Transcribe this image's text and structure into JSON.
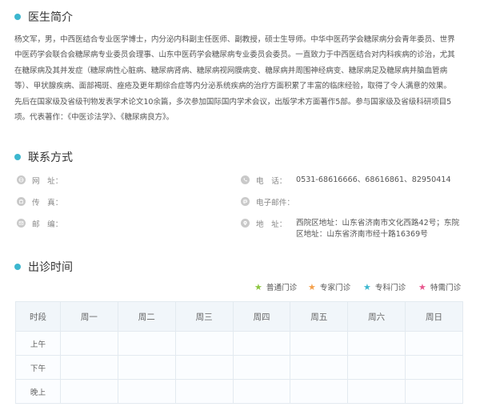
{
  "bio": {
    "title": "医生简介",
    "lines": [
      "杨文军，男，中西医结合专业医学博士，内分泌内科副主任医师、副教授，硕士生导师。中华中医药学会糖尿病分会青年委员、世界",
      "中医药学会联合会糖尿病专业委员会理事、山东中医药学会糖尿病专业委员会委员。一直致力于中西医结合对内科疾病的诊治，尤其",
      "在糖尿病及其并发症（糖尿病性心脏病、糖尿病肾病、糖尿病视网膜病变、糖尿病并周围神经病变、糖尿病足及糖尿病并脑血管病",
      "等）、甲状腺疾病、面部褐斑、痤疮及更年期综合症等内分泌系统疾病的治疗方面积累了丰富的临床经验，取得了令人满意的效果。",
      "先后在国家级及省级刊物发表学术论文10余篇，多次参加国际国内学术会议，出版学术方面著作5部。参与国家级及省级科研项目5",
      "项。代表著作：《中医诊法学》、《糖尿病良方》。"
    ]
  },
  "contact": {
    "title": "联系方式",
    "website_label": "网　址：",
    "website_value": "",
    "fax_label": "传　真：",
    "fax_value": "",
    "postcode_label": "邮　编：",
    "postcode_value": "",
    "phone_label": "电　话：",
    "phone_value": "0531-68616666、68616861、82950414",
    "email_label": "电子邮件：",
    "email_value": "",
    "address_label": "地　址：",
    "address_line1": "西院区地址：山东省济南市文化西路42号；东院",
    "address_line2": "区地址：山东省济南市经十路16369号"
  },
  "schedule": {
    "title": "出诊时间",
    "legend": [
      {
        "label": "普通门诊",
        "color": "#8cc63f"
      },
      {
        "label": "专家门诊",
        "color": "#f5a04a"
      },
      {
        "label": "专科门诊",
        "color": "#3cb7cf"
      },
      {
        "label": "特需门诊",
        "color": "#e8578e"
      }
    ],
    "header": {
      "period": "时段",
      "days": [
        "周一",
        "周二",
        "周三",
        "周四",
        "周五",
        "周六",
        "周日"
      ]
    },
    "rows": [
      "上午",
      "下午",
      "晚上"
    ]
  }
}
